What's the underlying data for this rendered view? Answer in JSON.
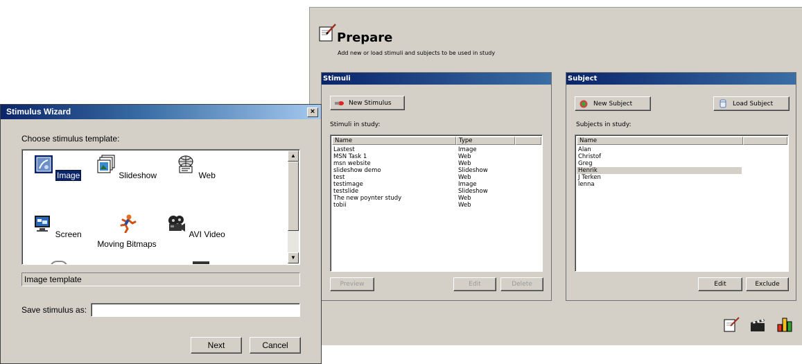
{
  "prepare": {
    "title": "Prepare",
    "subtitle": "Add new or load stimuli and subjects to be used in study",
    "stimuli": {
      "header": "Stimuli",
      "new_button": "New Stimulus",
      "list_label": "Stimuli in study:",
      "columns": [
        "Name",
        "Type"
      ],
      "rows": [
        [
          "Lastest",
          "Image"
        ],
        [
          "MSN Task 1",
          "Web"
        ],
        [
          "msn website",
          "Web"
        ],
        [
          "slideshow demo",
          "Slideshow"
        ],
        [
          "test",
          "Web"
        ],
        [
          "testimage",
          "Image"
        ],
        [
          "testslide",
          "Slideshow"
        ],
        [
          "The new poynter study",
          "Web"
        ],
        [
          "tobii",
          "Web"
        ]
      ],
      "preview_button": "Preview",
      "edit_button": "Edit",
      "delete_button": "Delete"
    },
    "subject": {
      "header": "Subject",
      "new_button": "New Subject",
      "load_button": "Load Subject",
      "list_label": "Subjects in study:",
      "columns": [
        "Name"
      ],
      "rows": [
        "Alan",
        "Christof",
        "Greg",
        "Henrik",
        "J Terken",
        "lenna"
      ],
      "selected": "Henrik",
      "edit_button": "Edit",
      "exclude_button": "Exclude"
    }
  },
  "wizard": {
    "title": "Stimulus Wizard",
    "close_glyph": "×",
    "prompt": "Choose stimulus template:",
    "templates": [
      {
        "label": "Image",
        "icon": "image-icon",
        "selected": true
      },
      {
        "label": "Slideshow",
        "icon": "slideshow-icon"
      },
      {
        "label": "Web",
        "icon": "web-icon"
      },
      {
        "label": "Screen",
        "icon": "screen-icon"
      },
      {
        "label": "Moving Bitmaps",
        "icon": "moving-bitmaps-icon"
      },
      {
        "label": "AVI Video",
        "icon": "avi-video-icon"
      }
    ],
    "description": "Image template",
    "save_label": "Save stimulus as:",
    "save_value": "",
    "next_button": "Next",
    "cancel_button": "Cancel"
  }
}
